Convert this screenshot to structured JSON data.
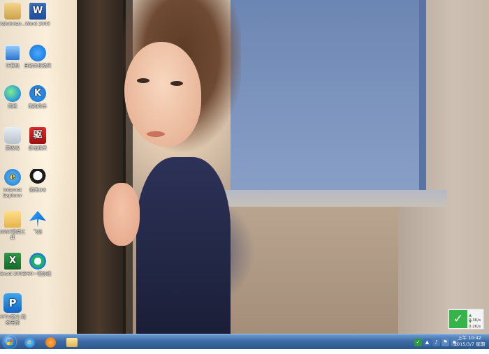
{
  "desktop": {
    "icons": [
      {
        "label": "Administr...",
        "icon": "user-folder-icon"
      },
      {
        "label": "Word 2003",
        "icon": "word-icon"
      },
      {
        "label": "计算机",
        "icon": "computer-icon"
      },
      {
        "label": "自动关机精灵",
        "icon": "bird-app-icon"
      },
      {
        "label": "网络",
        "icon": "network-icon"
      },
      {
        "label": "酷狗音乐",
        "icon": "kugou-icon"
      },
      {
        "label": "回收站",
        "icon": "recycle-bin-icon"
      },
      {
        "label": "驱动精灵",
        "icon": "driver-icon",
        "glyph": "驱"
      },
      {
        "label": "Internet Explorer",
        "icon": "ie-icon",
        "glyph": "e"
      },
      {
        "label": "腾讯QQ",
        "icon": "qq-icon"
      },
      {
        "label": "WIN7激活工具",
        "icon": "folder-icon"
      },
      {
        "label": "飞信",
        "icon": "fetion-icon"
      },
      {
        "label": "Excel 2003",
        "icon": "excel-icon",
        "glyph": "X"
      },
      {
        "label": "360一键加速",
        "icon": "ring-app-icon"
      },
      {
        "label": "PPTV聚力 网络电视",
        "icon": "pptv-icon",
        "glyph": "P"
      }
    ]
  },
  "net_widget": {
    "up_speed": "0.3K/s",
    "down_speed": "0.2K/s",
    "check_glyph": "✓",
    "up_arrow": "▲",
    "down_arrow": "▼"
  },
  "taskbar": {
    "start_icon": "windows-orb-icon",
    "pinned": [
      {
        "name": "internet-explorer",
        "icon": "ie-icon",
        "glyph": "e"
      },
      {
        "name": "uc-browser",
        "icon": "uc-browser-icon"
      },
      {
        "name": "file-explorer",
        "icon": "folder-icon"
      }
    ],
    "tray_icons": [
      "security-shield-icon",
      "network-tray-icon",
      "volume-icon",
      "flag-icon",
      "app-tray-icon"
    ],
    "clock": {
      "time": "上午 10:42",
      "date": "2015/3/7 星期六"
    }
  },
  "colors": {
    "taskbar": "#3d6ba6",
    "widget_green": "#35b44a"
  }
}
